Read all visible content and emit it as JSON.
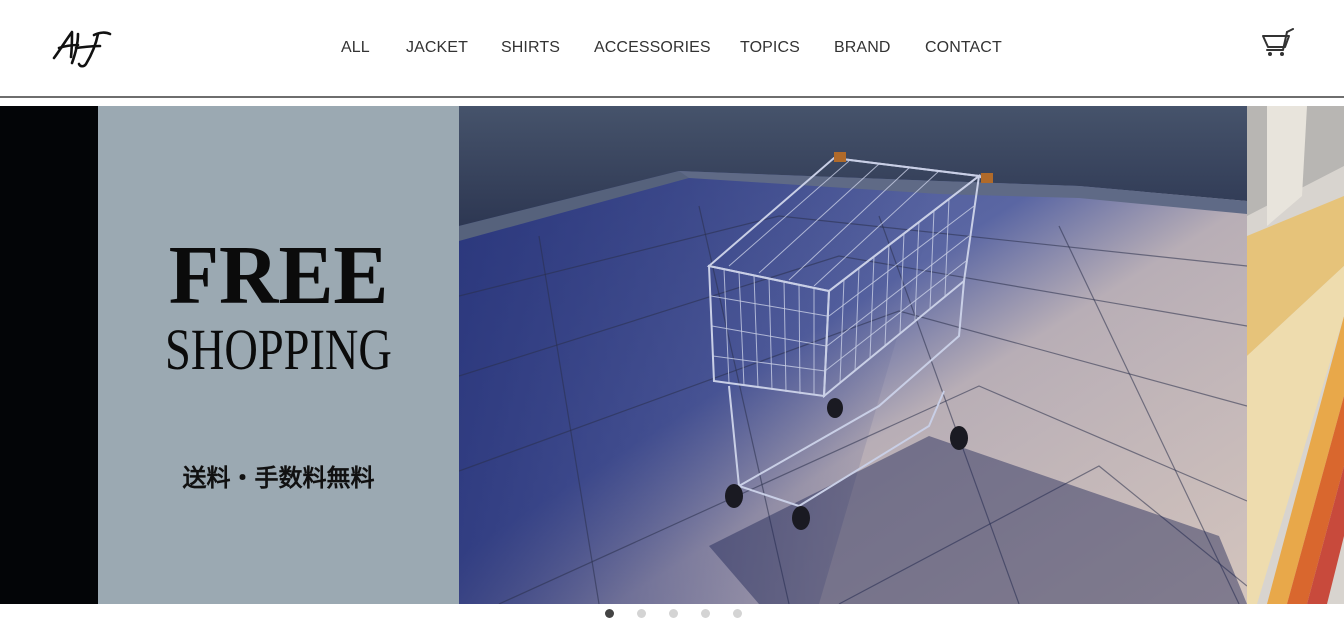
{
  "brand": {
    "logo_text": "AH"
  },
  "nav": {
    "items": [
      {
        "label": "ALL"
      },
      {
        "label": "JACKET"
      },
      {
        "label": "SHIRTS"
      },
      {
        "label": "ACCESSORIES"
      },
      {
        "label": "TOPICS"
      },
      {
        "label": "BRAND"
      },
      {
        "label": "CONTACT"
      }
    ]
  },
  "cart": {
    "icon": "cart-icon"
  },
  "hero": {
    "headline": "FREE",
    "subheadline": "SHOPPING",
    "tagline": "送料・手数料無料",
    "photo_subject": "shopping-cart-photo",
    "colors": {
      "strip": "#030507",
      "panel": "#9ba9b2"
    }
  },
  "carousel": {
    "slide_count": 5,
    "active_index": 0
  }
}
